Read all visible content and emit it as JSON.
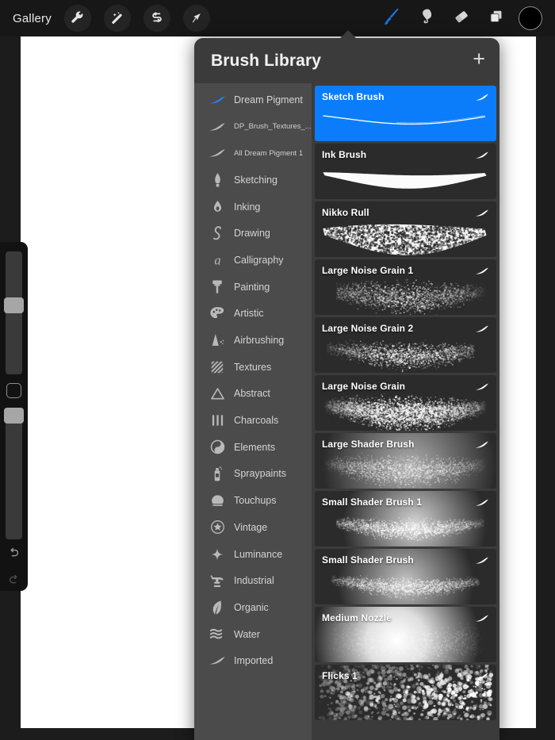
{
  "app": {
    "accent_blue": "#0b7dfb",
    "panel_bg": "#3b3b3b",
    "category_bg": "#4b4b4b",
    "card_bg": "#2b2b2b",
    "toolbar_bg": "#171717",
    "canvas_bg": "#ffffff"
  },
  "topbar": {
    "gallery_label": "Gallery",
    "left_tools": [
      {
        "name": "wrench-icon",
        "label": "Actions"
      },
      {
        "name": "magic-wand-icon",
        "label": "Adjustments"
      },
      {
        "name": "selection-icon",
        "label": "Selection"
      },
      {
        "name": "transform-arrow-icon",
        "label": "Transform"
      }
    ],
    "right_tools": [
      {
        "name": "paintbrush-icon",
        "label": "Paint",
        "active": true
      },
      {
        "name": "smudge-icon",
        "label": "Smudge",
        "active": false
      },
      {
        "name": "eraser-icon",
        "label": "Erase",
        "active": false
      },
      {
        "name": "layers-icon",
        "label": "Layers",
        "active": false
      }
    ],
    "color_swatch": "#000000"
  },
  "left_rail": {
    "size_slider": {
      "name": "brush-size-slider",
      "value_pct": 62
    },
    "opacity_slider": {
      "name": "brush-opacity-slider",
      "value_pct": 96
    },
    "modify_button": {
      "name": "modify-button"
    },
    "undo_button": {
      "name": "undo-button"
    },
    "redo_button": {
      "name": "redo-button"
    }
  },
  "panel": {
    "title": "Brush Library",
    "add_label": "+",
    "categories": [
      {
        "label": "Dream Pigment",
        "icon": "brush-swoosh-icon",
        "selected": true,
        "small": false
      },
      {
        "label": "DP_Brush_Textures_...",
        "icon": "brush-swoosh-icon",
        "selected": false,
        "small": true
      },
      {
        "label": "All Dream Pigment 1",
        "icon": "brush-swoosh-icon",
        "selected": false,
        "small": true
      },
      {
        "label": "Sketching",
        "icon": "pencil-tip-icon",
        "selected": false,
        "small": false
      },
      {
        "label": "Inking",
        "icon": "ink-drop-icon",
        "selected": false,
        "small": false
      },
      {
        "label": "Drawing",
        "icon": "squiggle-icon",
        "selected": false,
        "small": false
      },
      {
        "label": "Calligraphy",
        "icon": "letter-a-icon",
        "selected": false,
        "small": false
      },
      {
        "label": "Painting",
        "icon": "flat-brush-icon",
        "selected": false,
        "small": false
      },
      {
        "label": "Artistic",
        "icon": "palette-icon",
        "selected": false,
        "small": false
      },
      {
        "label": "Airbrushing",
        "icon": "airbrush-icon",
        "selected": false,
        "small": false
      },
      {
        "label": "Textures",
        "icon": "hatch-square-icon",
        "selected": false,
        "small": false
      },
      {
        "label": "Abstract",
        "icon": "triangle-icon",
        "selected": false,
        "small": false
      },
      {
        "label": "Charcoals",
        "icon": "three-bars-icon",
        "selected": false,
        "small": false
      },
      {
        "label": "Elements",
        "icon": "yin-yang-icon",
        "selected": false,
        "small": false
      },
      {
        "label": "Spraypaints",
        "icon": "spray-can-icon",
        "selected": false,
        "small": false
      },
      {
        "label": "Touchups",
        "icon": "dome-icon",
        "selected": false,
        "small": false
      },
      {
        "label": "Vintage",
        "icon": "star-circle-icon",
        "selected": false,
        "small": false
      },
      {
        "label": "Luminance",
        "icon": "sparkle-icon",
        "selected": false,
        "small": false
      },
      {
        "label": "Industrial",
        "icon": "anvil-icon",
        "selected": false,
        "small": false
      },
      {
        "label": "Organic",
        "icon": "leaf-icon",
        "selected": false,
        "small": false
      },
      {
        "label": "Water",
        "icon": "waves-icon",
        "selected": false,
        "small": false
      },
      {
        "label": "Imported",
        "icon": "brush-swoosh-icon",
        "selected": false,
        "small": false
      }
    ],
    "brushes": [
      {
        "name": "Sketch Brush",
        "selected": true,
        "stroke": "thin-taper",
        "edit_icon": "brush-edit-icon"
      },
      {
        "name": "Ink Brush",
        "selected": false,
        "stroke": "solid-ribbon",
        "edit_icon": "brush-edit-icon"
      },
      {
        "name": "Nikko Rull",
        "selected": false,
        "stroke": "rough-ribbon",
        "edit_icon": "brush-edit-icon"
      },
      {
        "name": "Large Noise Grain 1",
        "selected": false,
        "stroke": "noise-light",
        "edit_icon": "brush-edit-icon"
      },
      {
        "name": "Large Noise Grain 2",
        "selected": false,
        "stroke": "noise-sparse",
        "edit_icon": "brush-edit-icon"
      },
      {
        "name": "Large Noise Grain",
        "selected": false,
        "stroke": "noise-dense",
        "edit_icon": "brush-edit-icon"
      },
      {
        "name": "Large Shader Brush",
        "selected": false,
        "stroke": "shader-soft",
        "edit_icon": "brush-edit-icon"
      },
      {
        "name": "Small Shader Brush 1",
        "selected": false,
        "stroke": "shader-tight",
        "edit_icon": "brush-edit-icon"
      },
      {
        "name": "Small Shader Brush",
        "selected": false,
        "stroke": "shader-narrow",
        "edit_icon": "brush-edit-icon"
      },
      {
        "name": "Medium Nozzle",
        "selected": false,
        "stroke": "glow-blob",
        "edit_icon": "brush-edit-icon"
      },
      {
        "name": "Flicks 1",
        "selected": false,
        "stroke": "speckle",
        "edit_icon": "brush-edit-icon"
      }
    ]
  }
}
